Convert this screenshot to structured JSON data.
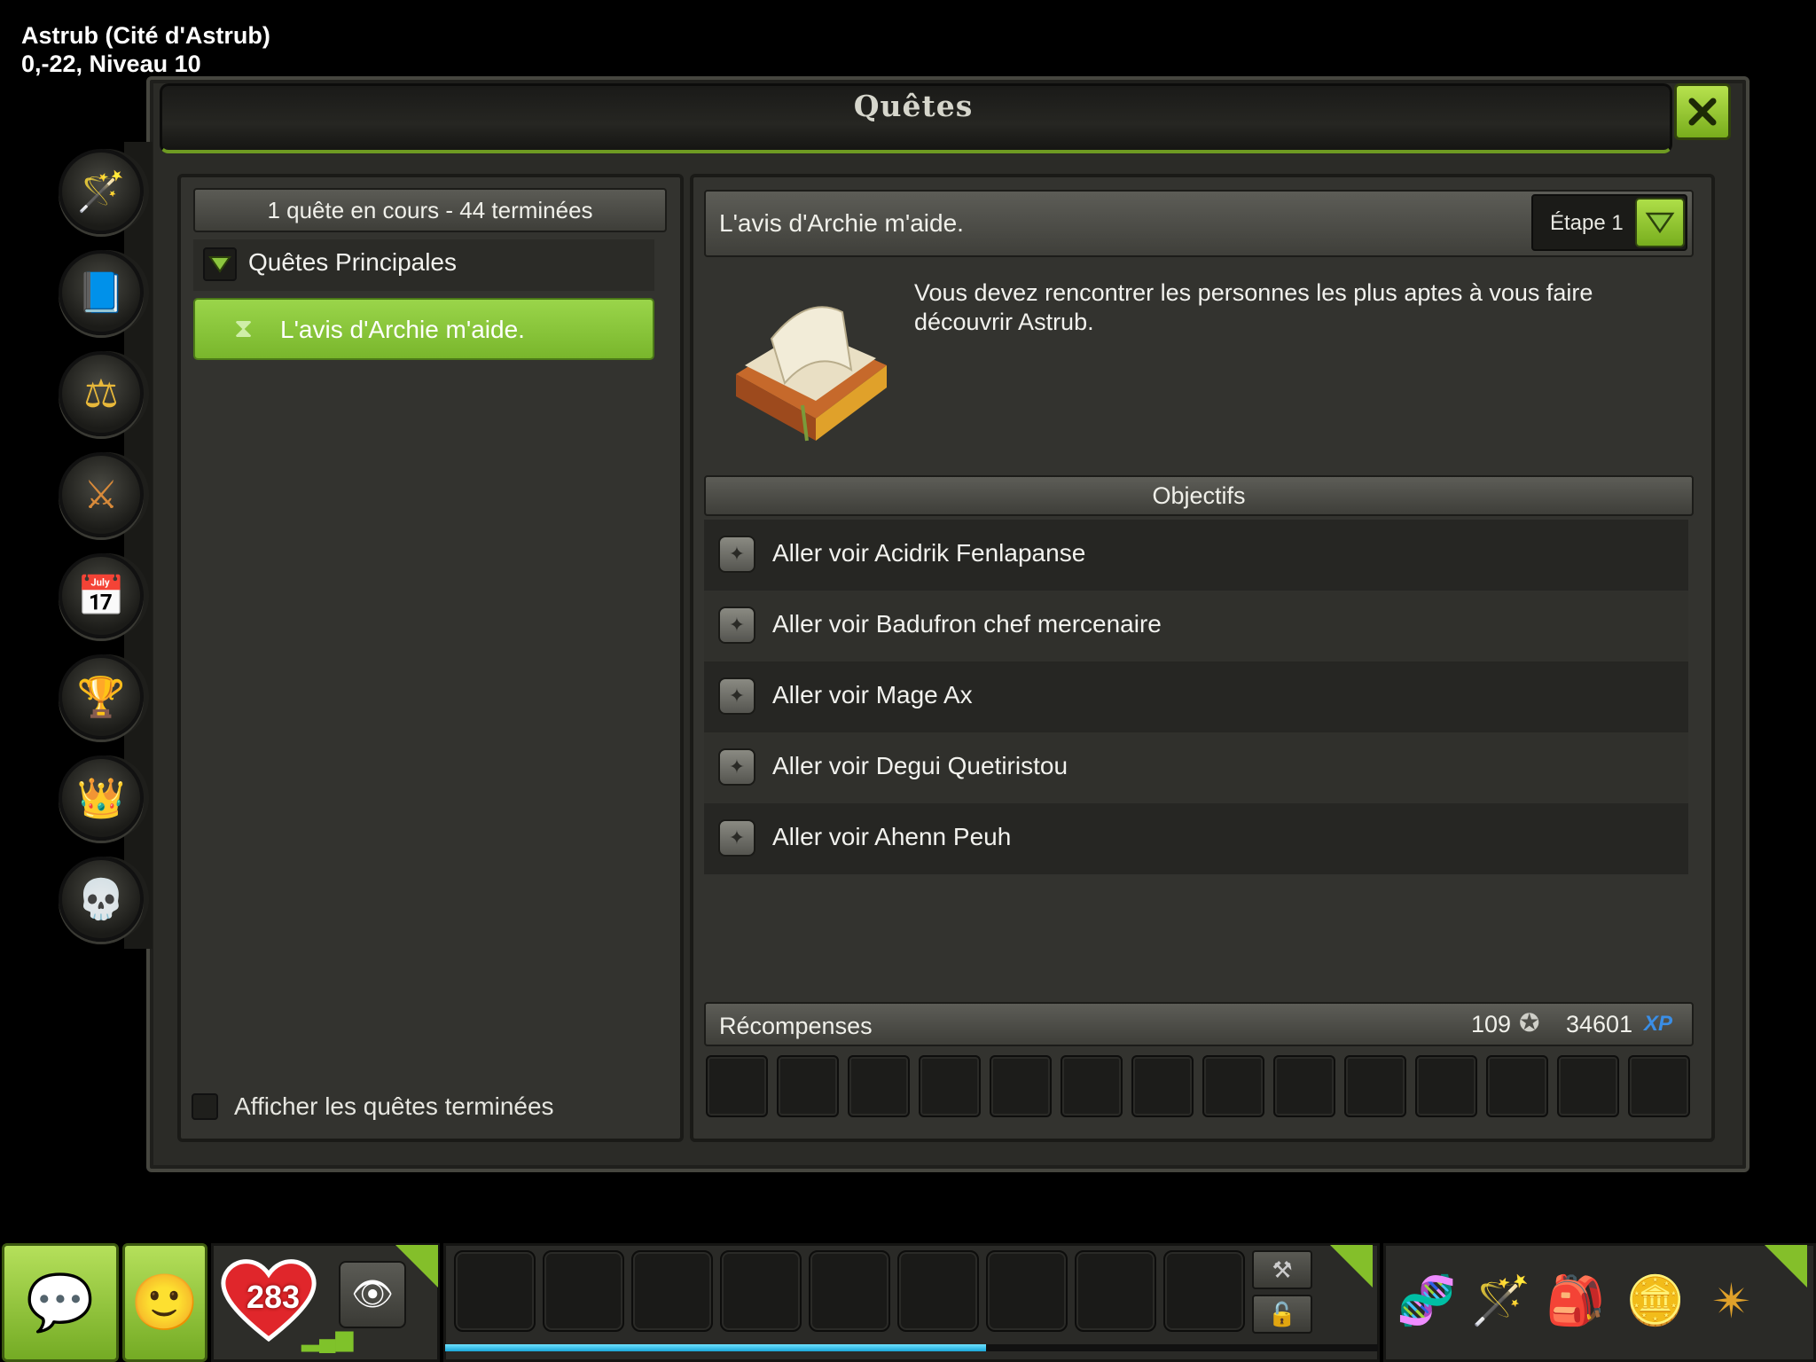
{
  "location": {
    "zone": "Astrub (Cité d'Astrub)",
    "coords_level": "0,-22, Niveau 10"
  },
  "window": {
    "title": "Quêtes",
    "close_icon": "close-x-icon"
  },
  "side_tabs": [
    {
      "name": "quests-tab",
      "icon": "wand-star-icon",
      "glyph": "🪄"
    },
    {
      "name": "bestiary-tab",
      "icon": "book-icon",
      "glyph": "📘"
    },
    {
      "name": "alignment-tab",
      "icon": "scales-icon",
      "glyph": "⚖"
    },
    {
      "name": "jobs-tab",
      "icon": "crossed-tools-icon",
      "glyph": "⚔"
    },
    {
      "name": "calendar-tab",
      "icon": "calendar-icon",
      "glyph": "📅"
    },
    {
      "name": "achievements-tab",
      "icon": "trophy-icon",
      "glyph": "🏆"
    },
    {
      "name": "almanax-tab",
      "icon": "crown-icon",
      "glyph": "👑"
    },
    {
      "name": "bestiary-monsters-tab",
      "icon": "monster-skull-icon",
      "glyph": "💀"
    }
  ],
  "left": {
    "summary": "1 quête en cours - 44 terminées",
    "category": "Quêtes Principales",
    "selected_quest": "L'avis d'Archie m'aide.",
    "show_completed": "Afficher les quêtes terminées"
  },
  "quest": {
    "title": "L'avis d'Archie m'aide.",
    "step": "Étape 1",
    "description": "Vous devez rencontrer les personnes les plus aptes à vous faire découvrir Astrub.",
    "objectives_header": "Objectifs",
    "objectives": [
      "Aller voir Acidrik Fenlapanse",
      "Aller voir Badufron chef mercenaire",
      "Aller voir Mage Ax",
      "Aller voir Degui Quetiristou",
      "Aller voir Ahenn Peuh"
    ],
    "rewards_header": "Récompenses",
    "kamas": "109",
    "xp": "34601",
    "xp_label": "XP"
  },
  "hud": {
    "hp": "283",
    "xp_progress": 0.58
  },
  "colors": {
    "accent_green": "#8cc63f",
    "xp_blue": "#3a8ee6"
  }
}
